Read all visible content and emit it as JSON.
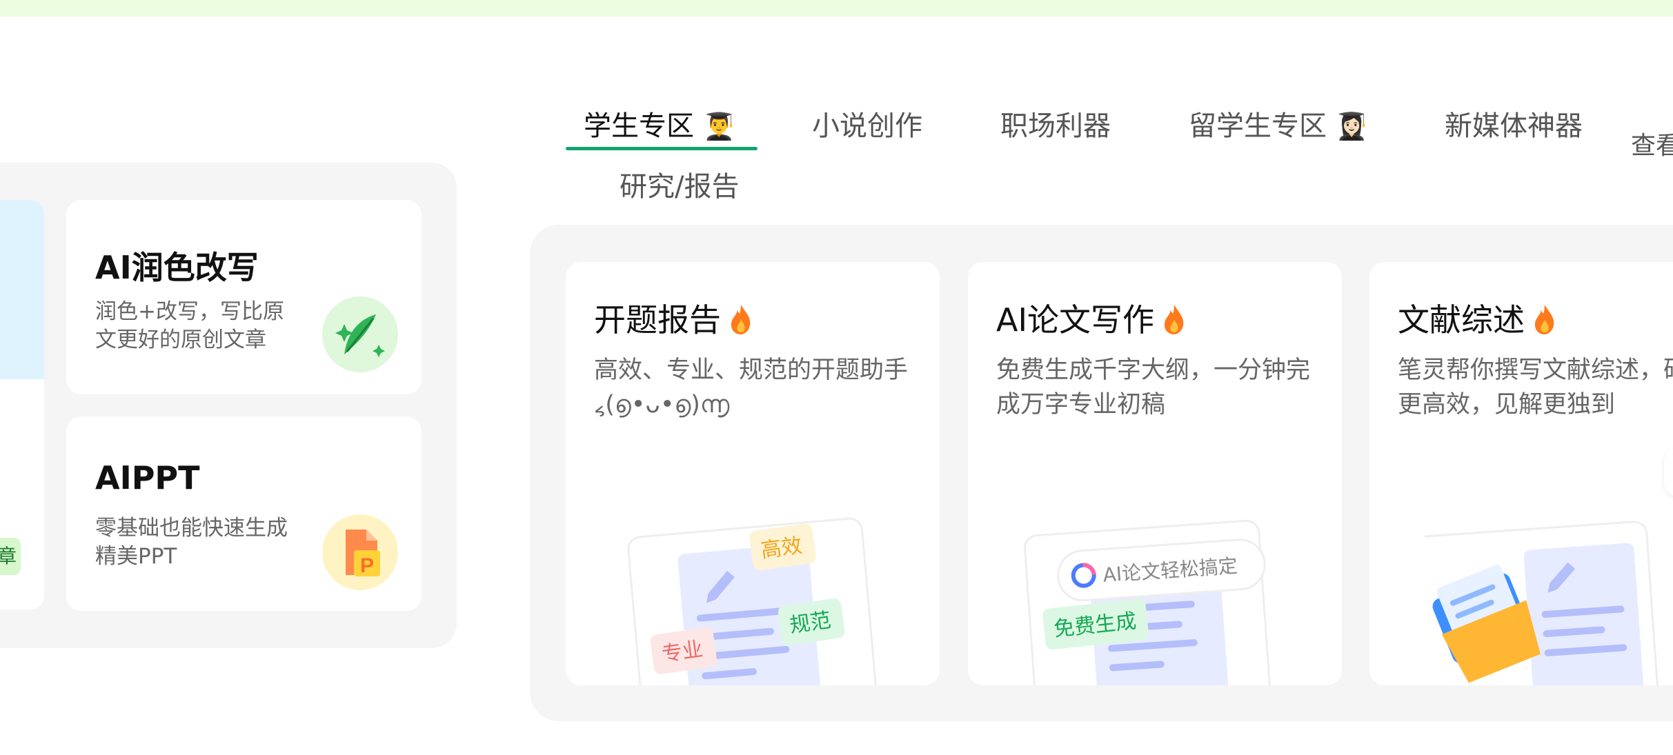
{
  "tabs": {
    "items": [
      {
        "label": "学生专区",
        "emoji": "👨‍🎓"
      },
      {
        "label": "小说创作"
      },
      {
        "label": "职场利器"
      },
      {
        "label": "留学生专区",
        "emoji": "👩🏻‍🎓"
      },
      {
        "label": "新媒体神器"
      },
      {
        "label": "查看"
      },
      {
        "label": "研究/报告"
      }
    ],
    "active": "学生专区",
    "accent_color": "#13a46e"
  },
  "left_panel": {
    "partial_tag": "章",
    "cards": [
      {
        "title": "AI润色改写",
        "desc": "润色+改写，写比原文更好的原创文章",
        "icon": "feather-sparkle-icon"
      },
      {
        "title": "AIPPT",
        "desc": "零基础也能快速生成精美PPT",
        "icon": "ppt-file-icon"
      }
    ]
  },
  "features": [
    {
      "title": "开题报告",
      "desc": "高效、专业、规范的开题助手 ៹(൭•ᴗ•൭)൬",
      "tags": [
        "高效",
        "规范",
        "专业"
      ]
    },
    {
      "title": "AI论文写作",
      "desc": "免费生成千字大纲，一分钟完成万字专业初稿",
      "pill": "AI论文轻松搞定",
      "tag": "免费生成"
    },
    {
      "title": "文献综述",
      "desc": "笔灵帮你撰写文献综述，研究更高效，见解更独到"
    }
  ]
}
